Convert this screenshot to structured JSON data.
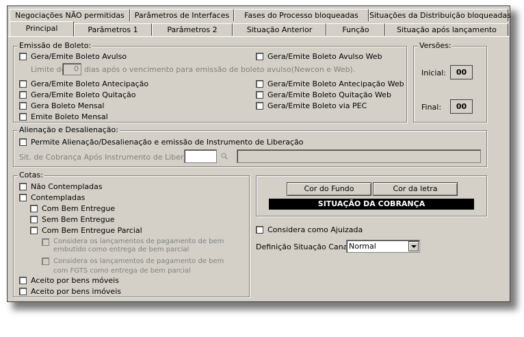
{
  "tabs_row1": [
    "Negociações NÃO permitidas",
    "Parâmetros de Interfaces",
    "Fases do Processo bloqueadas",
    "Situações da Distribuição bloqueadas"
  ],
  "tabs_row2": [
    "Principal",
    "Parâmetros 1",
    "Parâmetros 2",
    "Situação Anterior",
    "Função",
    "Situação após lançamento"
  ],
  "boleto": {
    "legend": "Emissão de Boleto:",
    "avulso": "Gera/Emite Boleto Avulso",
    "avulso_web": "Gera/Emite Boleto Avulso Web",
    "limite_prefix": "Limite de",
    "limite_value": "0",
    "limite_suffix": "dias após o vencimento para emissão de boleto avulso(Newcon e Web).",
    "antecipacao": "Gera/Emite Boleto Antecipação",
    "antecipacao_web": "Gera/Emite Boleto Antecipação Web",
    "quitacao": "Gera/Emite Boleto Quitação",
    "quitacao_web": "Gera/Emite Boleto Quitação Web",
    "mensal": "Gera Boleto Mensal",
    "pec": "Gera/Emite Boleto via PEC",
    "emite_mensal": "Emite Boleto Mensal"
  },
  "versoes": {
    "legend": "Versões:",
    "inicial_label": "Inicial:",
    "inicial_value": "00",
    "final_label": "Final:",
    "final_value": "00"
  },
  "alienacao": {
    "legend": "Alienação e Desalienação:",
    "permite": "Permite Alienação/Desalienação e emissão de Instrumento de Liberação",
    "sit_label": "Sit. de Cobrança Após Instrumento de Liberação:"
  },
  "cotas": {
    "legend": "Cotas:",
    "nao_contempladas": "Não Contempladas",
    "contempladas": "Contempladas",
    "com_bem": "Com Bem Entregue",
    "sem_bem": "Sem Bem Entregue",
    "com_bem_parcial": "Com Bem Entregue Parcial",
    "considera1_line1": "Considera os lançamentos de pagamento de bem",
    "considera1_line2": "embutido como entrega de bem parcial",
    "considera2_line1": "Considera os lançamentos de pagamento de bem",
    "considera2_line2": "com FGTS como entrega de bem parcial",
    "moveis": "Aceito por bens móveis",
    "imoveis": "Aceito por bens imóveis"
  },
  "cores": {
    "fundo_button": "Cor do Fundo",
    "letra_button": "Cor da letra",
    "preview_text": "SITUAÇÃO DA COBRANÇA"
  },
  "ajuizada": "Considera como Ajuizada",
  "canal": {
    "label": "Definição Situação Canal:",
    "value": "Normal"
  },
  "colors": {
    "window_bg": "#d4d0c8",
    "preview_bg": "#000000",
    "preview_fg": "#ffffff"
  }
}
